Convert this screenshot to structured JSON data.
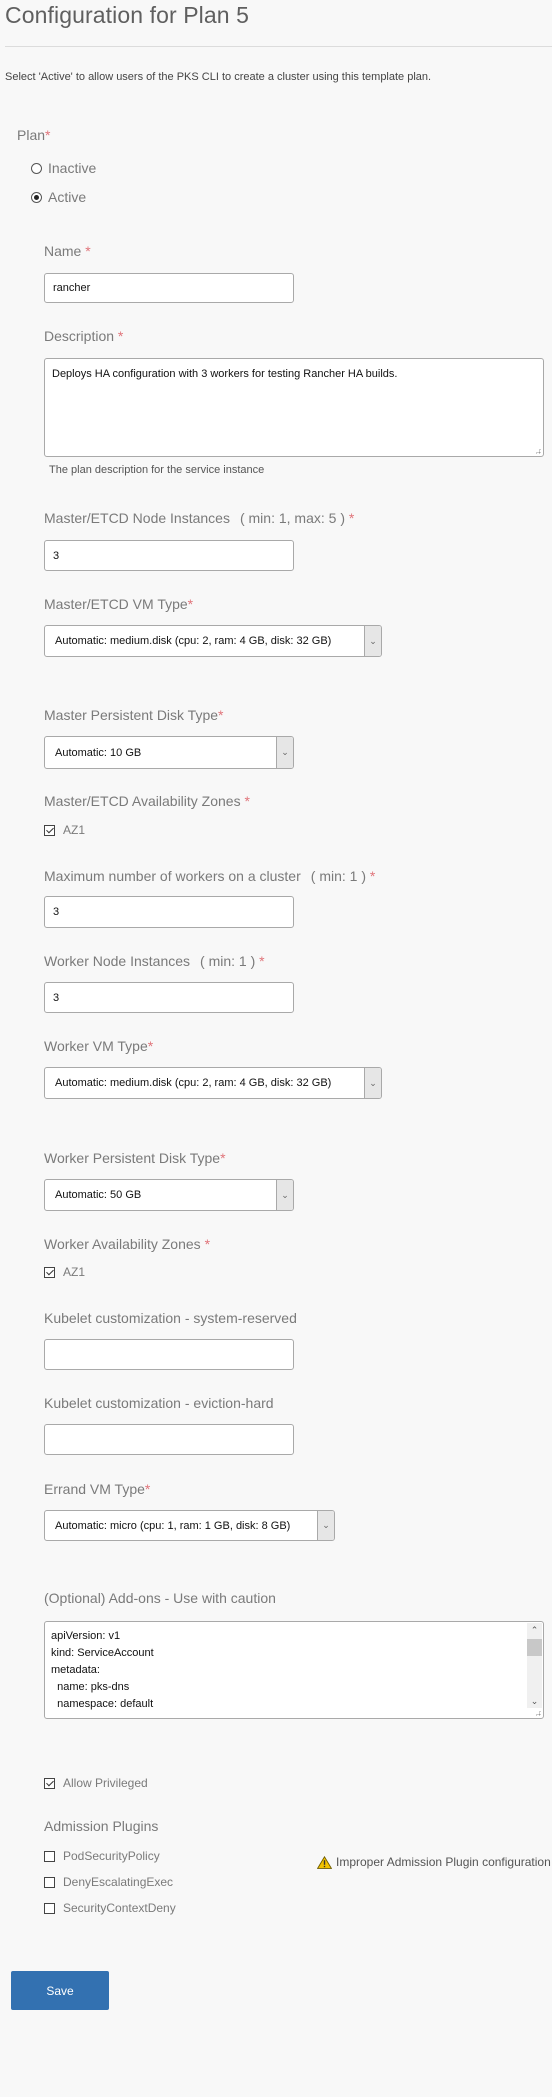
{
  "header": {
    "title": "Configuration for Plan 5",
    "intro": "Select 'Active' to allow users of the PKS CLI to create a cluster using this template plan."
  },
  "plan": {
    "label": "Plan",
    "required": "*",
    "options": [
      {
        "label": "Inactive",
        "selected": false
      },
      {
        "label": "Active",
        "selected": true
      }
    ]
  },
  "fields": {
    "name": {
      "label": "Name",
      "required": "*",
      "value": "rancher"
    },
    "description": {
      "label": "Description",
      "required": "*",
      "value": "Deploys HA configuration with 3 workers for testing Rancher HA builds.",
      "helper": "The plan description for the service instance"
    },
    "master_instances": {
      "label": "Master/ETCD Node Instances",
      "range": "( min: 1, max: 5 )",
      "required": "*",
      "value": "3"
    },
    "master_vm_type": {
      "label": "Master/ETCD VM Type",
      "required": "*",
      "value": "Automatic: medium.disk (cpu: 2, ram: 4 GB, disk: 32 GB)"
    },
    "master_disk_type": {
      "label": "Master Persistent Disk Type",
      "required": "*",
      "value": "Automatic: 10 GB"
    },
    "master_azs": {
      "label": "Master/ETCD Availability Zones",
      "required": "*",
      "options": [
        {
          "label": "AZ1",
          "checked": true
        }
      ]
    },
    "max_workers": {
      "label": "Maximum number of workers on a cluster",
      "range": "( min: 1 )",
      "required": "*",
      "value": "3"
    },
    "worker_instances": {
      "label": "Worker Node Instances",
      "range": "( min: 1 )",
      "required": "*",
      "value": "3"
    },
    "worker_vm_type": {
      "label": "Worker VM Type",
      "required": "*",
      "value": "Automatic: medium.disk (cpu: 2, ram: 4 GB, disk: 32 GB)"
    },
    "worker_disk_type": {
      "label": "Worker Persistent Disk Type",
      "required": "*",
      "value": "Automatic: 50 GB"
    },
    "worker_azs": {
      "label": "Worker Availability Zones",
      "required": "*",
      "options": [
        {
          "label": "AZ1",
          "checked": true
        }
      ]
    },
    "kubelet_system_reserved": {
      "label": "Kubelet customization - system-reserved",
      "value": ""
    },
    "kubelet_eviction_hard": {
      "label": "Kubelet customization - eviction-hard",
      "value": ""
    },
    "errand_vm_type": {
      "label": "Errand VM Type",
      "required": "*",
      "value": "Automatic: micro (cpu: 1, ram: 1 GB, disk: 8 GB)"
    },
    "addons": {
      "label": "(Optional) Add-ons - Use with caution",
      "lines": [
        "apiVersion: v1",
        "kind: ServiceAccount",
        "metadata:",
        "  name: pks-dns",
        "  namespace: default"
      ]
    },
    "allow_privileged": {
      "label": "Allow Privileged",
      "checked": true
    },
    "admission_plugins": {
      "label": "Admission Plugins",
      "options": [
        {
          "label": "PodSecurityPolicy",
          "checked": false
        },
        {
          "label": "DenyEscalatingExec",
          "checked": false
        },
        {
          "label": "SecurityContextDeny",
          "checked": false
        }
      ],
      "warning": "Improper Admission Plugin configuration"
    }
  },
  "actions": {
    "save_label": "Save"
  },
  "colors": {
    "accent": "#3371b1",
    "required": "#e0747a",
    "warning": "#f2c200"
  }
}
